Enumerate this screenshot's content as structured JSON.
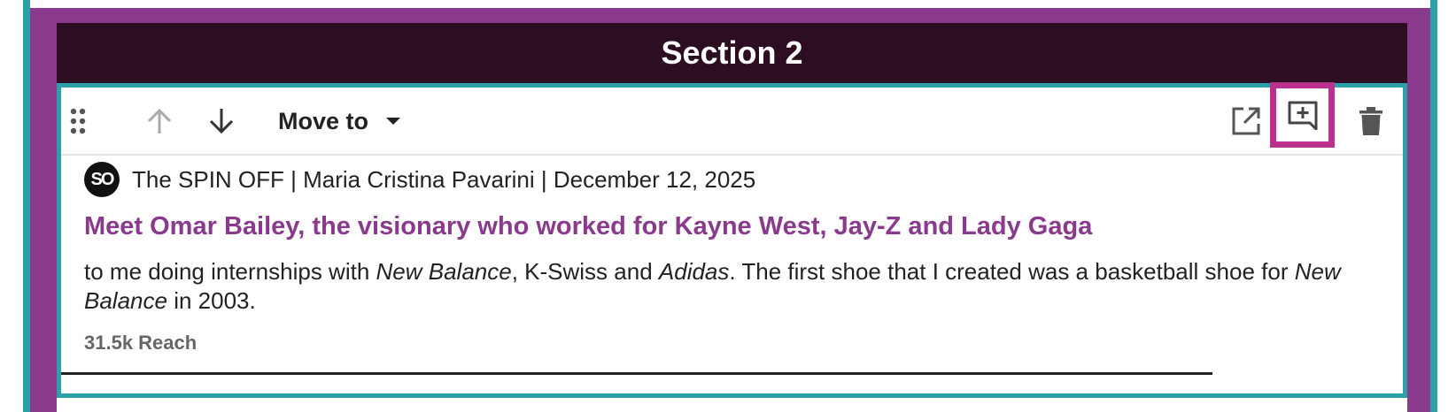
{
  "section": {
    "title": "Section 2"
  },
  "toolbar": {
    "move_to_label": "Move to",
    "icons": [
      "drag-handle-icon",
      "arrow-up-icon",
      "arrow-down-icon",
      "open-in-new-icon",
      "add-comment-icon",
      "trash-icon"
    ]
  },
  "article": {
    "avatar_text": "SO",
    "source_line": "The SPIN OFF | Maria Cristina Pavarini | December 12, 2025",
    "headline": "Meet Omar Bailey, the visionary who worked for Kayne West, Jay-Z and Lady Gaga",
    "excerpt": {
      "part1": "to me doing internships with ",
      "em1": "New Balance",
      "part2": ", K-Swiss and ",
      "em2": "Adidas",
      "part3": ". The first shoe that I created was a basketball shoe for ",
      "em3": "New Balance",
      "part4": " in 2003."
    },
    "reach": "31.5k Reach"
  },
  "colors": {
    "accent_purple": "#8a3a8d",
    "header_dark": "#2c0d22",
    "teal_border": "#2ba0a6",
    "highlight_magenta": "#b9308f"
  }
}
